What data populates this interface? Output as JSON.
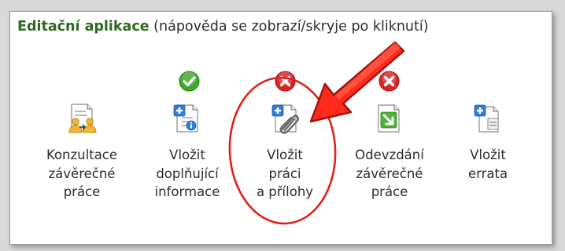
{
  "panel": {
    "title": "Editační aplikace",
    "hint": " (nápověda se zobrazí/skryje po kliknutí)"
  },
  "apps": [
    {
      "line1": "Konzultace",
      "line2": "závěrečné",
      "line3": "práce",
      "status": "none"
    },
    {
      "line1": "Vložit",
      "line2": "doplňující",
      "line3": "informace",
      "status": "ok"
    },
    {
      "line1": "Vložit",
      "line2": "práci",
      "line3": "a přílohy",
      "status": "error"
    },
    {
      "line1": "Odevzdání",
      "line2": "závěrečné",
      "line3": "práce",
      "status": "error"
    },
    {
      "line1": "Vložit",
      "line2": "errata",
      "line3": "",
      "status": "none"
    }
  ],
  "colors": {
    "ok": "#3fa82a",
    "error": "#d82323",
    "annotation": "#e0201a",
    "title": "#2d6a1f"
  }
}
